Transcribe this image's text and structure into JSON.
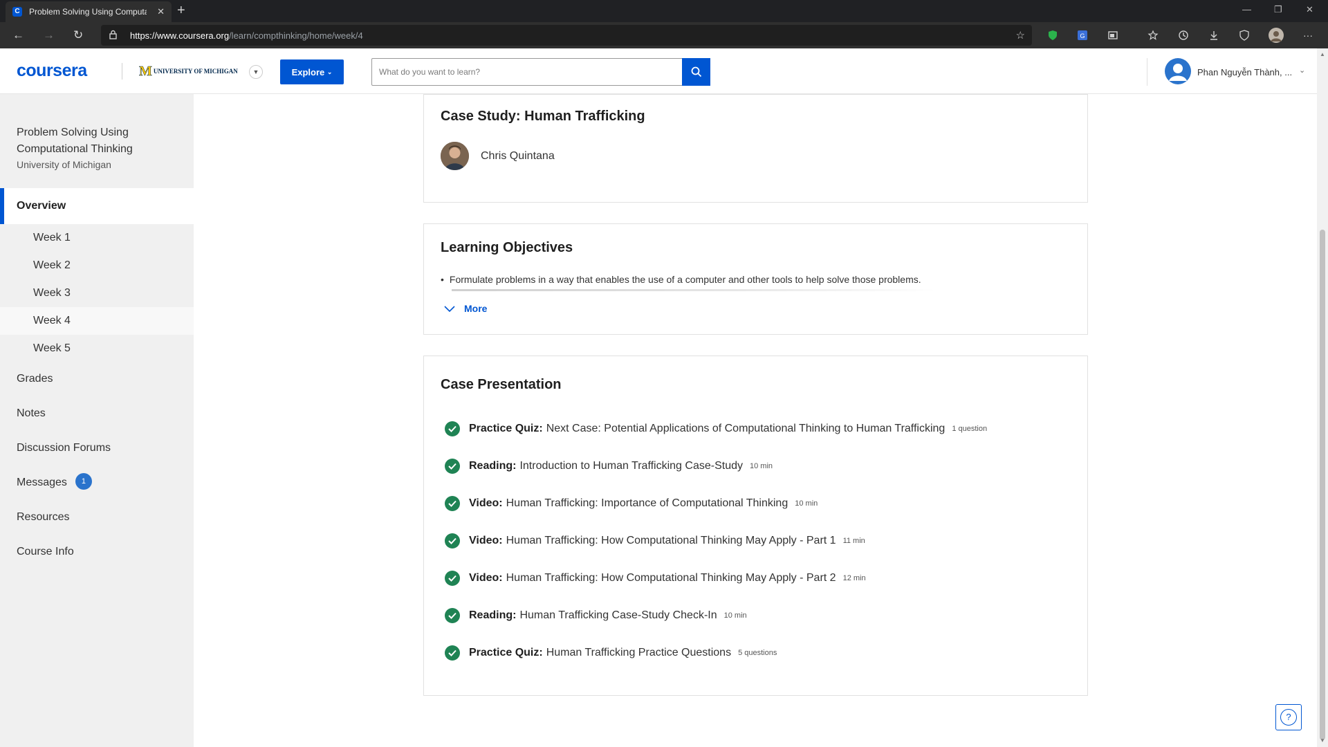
{
  "browser": {
    "tab_title": "Problem Solving Using Computa",
    "url_host": "https://www.coursera.org",
    "url_path": "/learn/compthinking/home/week/4"
  },
  "header": {
    "logo": "coursera",
    "partner_initial": "M",
    "partner_name": "UNIVERSITY OF MICHIGAN",
    "explore_label": "Explore",
    "search_placeholder": "What do you want to learn?",
    "user_name": "Phan Nguyễn Thành, ..."
  },
  "sidebar": {
    "course_title": "Problem Solving Using Computational Thinking",
    "course_partner": "University of Michigan",
    "overview_label": "Overview",
    "weeks": [
      "Week 1",
      "Week 2",
      "Week 3",
      "Week 4",
      "Week 5"
    ],
    "active_week": "Week 4",
    "items": [
      {
        "label": "Grades"
      },
      {
        "label": "Notes"
      },
      {
        "label": "Discussion Forums"
      },
      {
        "label": "Messages",
        "badge": "1"
      },
      {
        "label": "Resources"
      },
      {
        "label": "Course Info"
      }
    ]
  },
  "case_study": {
    "title": "Case Study: Human Trafficking",
    "instructor": "Chris Quintana"
  },
  "objectives": {
    "title": "Learning Objectives",
    "first_item": "Formulate problems in a way that enables the use of a computer and other tools to help solve those problems.",
    "more_label": "More"
  },
  "presentation": {
    "title": "Case Presentation",
    "items": [
      {
        "type": "Practice Quiz:",
        "title": "Next Case: Potential Applications of Computational Thinking to Human Trafficking",
        "meta": "1 question"
      },
      {
        "type": "Reading:",
        "title": "Introduction to Human Trafficking Case-Study",
        "meta": "10 min"
      },
      {
        "type": "Video:",
        "title": "Human Trafficking: Importance of Computational Thinking",
        "meta": "10 min"
      },
      {
        "type": "Video:",
        "title": "Human Trafficking: How Computational Thinking May Apply - Part 1",
        "meta": "11 min"
      },
      {
        "type": "Video:",
        "title": "Human Trafficking: How Computational Thinking May Apply - Part 2",
        "meta": "12 min"
      },
      {
        "type": "Reading:",
        "title": "Human Trafficking Case-Study Check-In",
        "meta": "10 min"
      },
      {
        "type": "Practice Quiz:",
        "title": "Human Trafficking Practice Questions",
        "meta": "5 questions"
      }
    ]
  },
  "help": {
    "label": "?"
  },
  "colors": {
    "brand": "#0056d2",
    "completed": "#1f8354",
    "sidebar_bg": "#f0f0f0"
  }
}
